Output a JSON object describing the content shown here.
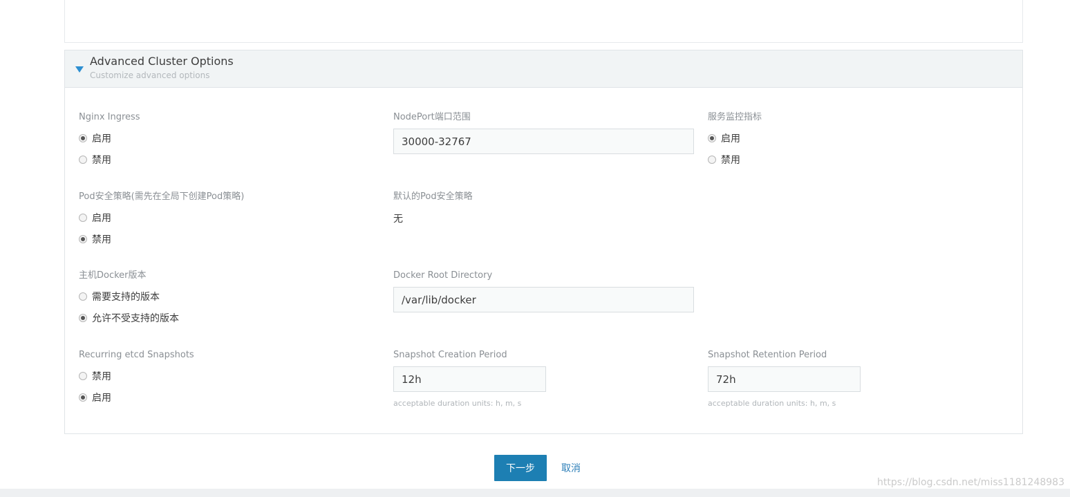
{
  "advanced": {
    "title": "Advanced Cluster Options",
    "subtitle": "Customize advanced options"
  },
  "nginx_ingress": {
    "label": "Nginx Ingress",
    "options": [
      "启用",
      "禁用"
    ],
    "selected": "启用"
  },
  "nodeport_range": {
    "label": "NodePort端口范围",
    "value": "30000-32767"
  },
  "monitoring": {
    "label": "服务监控指标",
    "options": [
      "启用",
      "禁用"
    ],
    "selected": "启用"
  },
  "pod_security": {
    "label": "Pod安全策略(需先在全局下创建Pod策略)",
    "options": [
      "启用",
      "禁用"
    ],
    "selected": "禁用"
  },
  "default_psp": {
    "label": "默认的Pod安全策略",
    "value": "无"
  },
  "docker_version": {
    "label": "主机Docker版本",
    "options": [
      "需要支持的版本",
      "允许不受支持的版本"
    ],
    "selected": "允许不受支持的版本"
  },
  "docker_root": {
    "label": "Docker Root Directory",
    "value": "/var/lib/docker"
  },
  "etcd_snapshots": {
    "label": "Recurring etcd Snapshots",
    "options": [
      "禁用",
      "启用"
    ],
    "selected": "启用"
  },
  "snapshot_creation": {
    "label": "Snapshot Creation Period",
    "value": "12h",
    "help": "acceptable duration units: h, m, s"
  },
  "snapshot_retention": {
    "label": "Snapshot Retention Period",
    "value": "72h",
    "help": "acceptable duration units: h, m, s"
  },
  "actions": {
    "next": "下一步",
    "cancel": "取消"
  },
  "watermark": "https://blog.csdn.net/miss1181248983",
  "colors": {
    "primary": "#1d7fb3",
    "link": "#2d7fb8",
    "caret": "#2e8fd1"
  }
}
